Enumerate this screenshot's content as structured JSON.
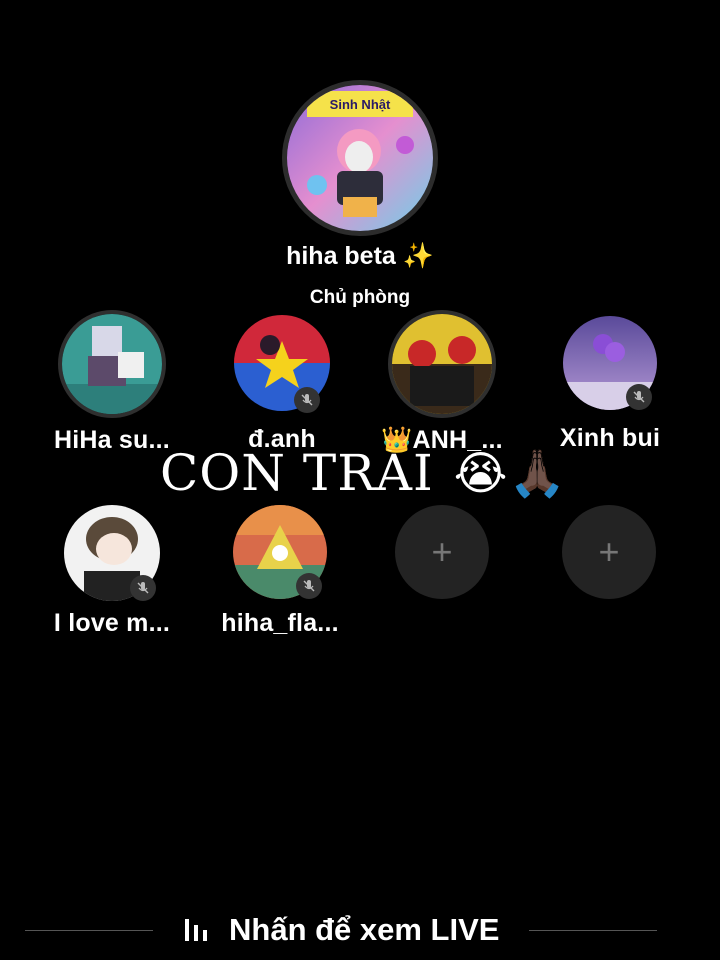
{
  "host": {
    "name": "hiha beta ✨",
    "role": "Chủ phòng",
    "avatar_banner": "Sinh Nhật"
  },
  "seats_row1": [
    {
      "name": "HiHa su...",
      "muted": false
    },
    {
      "name": "đ.anh",
      "muted": true
    },
    {
      "name": "👑ANH_...",
      "muted": false
    },
    {
      "name": "Xinh bui",
      "muted": true
    }
  ],
  "seats_row2": [
    {
      "name": "I love m...",
      "muted": true
    },
    {
      "name": "hiha_fla...",
      "muted": true
    },
    {
      "name": "",
      "empty": true
    },
    {
      "name": "",
      "empty": true
    }
  ],
  "overlay": {
    "text": "CON TRAI",
    "emoji": "😭🙏🏿"
  },
  "footer": {
    "label": "Nhấn để xem LIVE",
    "icon": "audio-bars-icon"
  },
  "icons": {
    "mute": "mic-off-icon",
    "add": "plus-icon"
  }
}
